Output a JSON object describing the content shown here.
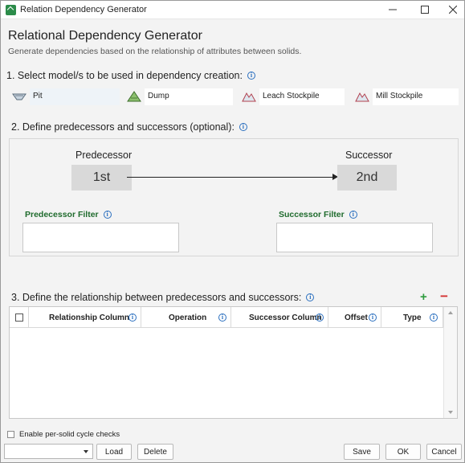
{
  "window": {
    "title": "Relation Dependency Generator",
    "controls": [
      "minimize",
      "maximize",
      "close"
    ]
  },
  "header": {
    "title": "Relational Dependency Generator",
    "subtitle": "Generate dependencies based on the relationship of attributes between solids."
  },
  "section1": {
    "label": "1. Select model/s to be used in dependency creation:",
    "models": [
      {
        "label": "Pit",
        "icon": "pit-model-icon",
        "selected": true
      },
      {
        "label": "Dump",
        "icon": "dump-model-icon",
        "selected": false
      },
      {
        "label": "Leach Stockpile",
        "icon": "stockpile-model-icon",
        "selected": false
      },
      {
        "label": "Mill Stockpile",
        "icon": "stockpile-model-icon",
        "selected": false
      }
    ]
  },
  "section2": {
    "label": "2. Define predecessors and successors (optional):",
    "predecessor_title": "Predecessor",
    "successor_title": "Successor",
    "predecessor_value": "1st",
    "successor_value": "2nd",
    "predecessor_filter_label": "Predecessor Filter",
    "successor_filter_label": "Successor Filter",
    "predecessor_filter_value": "",
    "successor_filter_value": ""
  },
  "section3": {
    "label": "3. Define the relationship between predecessors and successors:",
    "add_symbol": "+",
    "remove_symbol": "−",
    "columns": [
      "Relationship Column",
      "Operation",
      "Successor Column",
      "Offset",
      "Type"
    ],
    "rows": []
  },
  "footer": {
    "cycle_check_label": "Enable per-solid cycle checks",
    "cycle_check_checked": false,
    "preset_value": "",
    "load_label": "Load",
    "delete_label": "Delete",
    "save_label": "Save",
    "ok_label": "OK",
    "cancel_label": "Cancel"
  },
  "colors": {
    "accent_green": "#1f6b2d",
    "info_blue": "#2a6fbf",
    "add_green": "#2e9b3e",
    "remove_red": "#d32f2f"
  }
}
